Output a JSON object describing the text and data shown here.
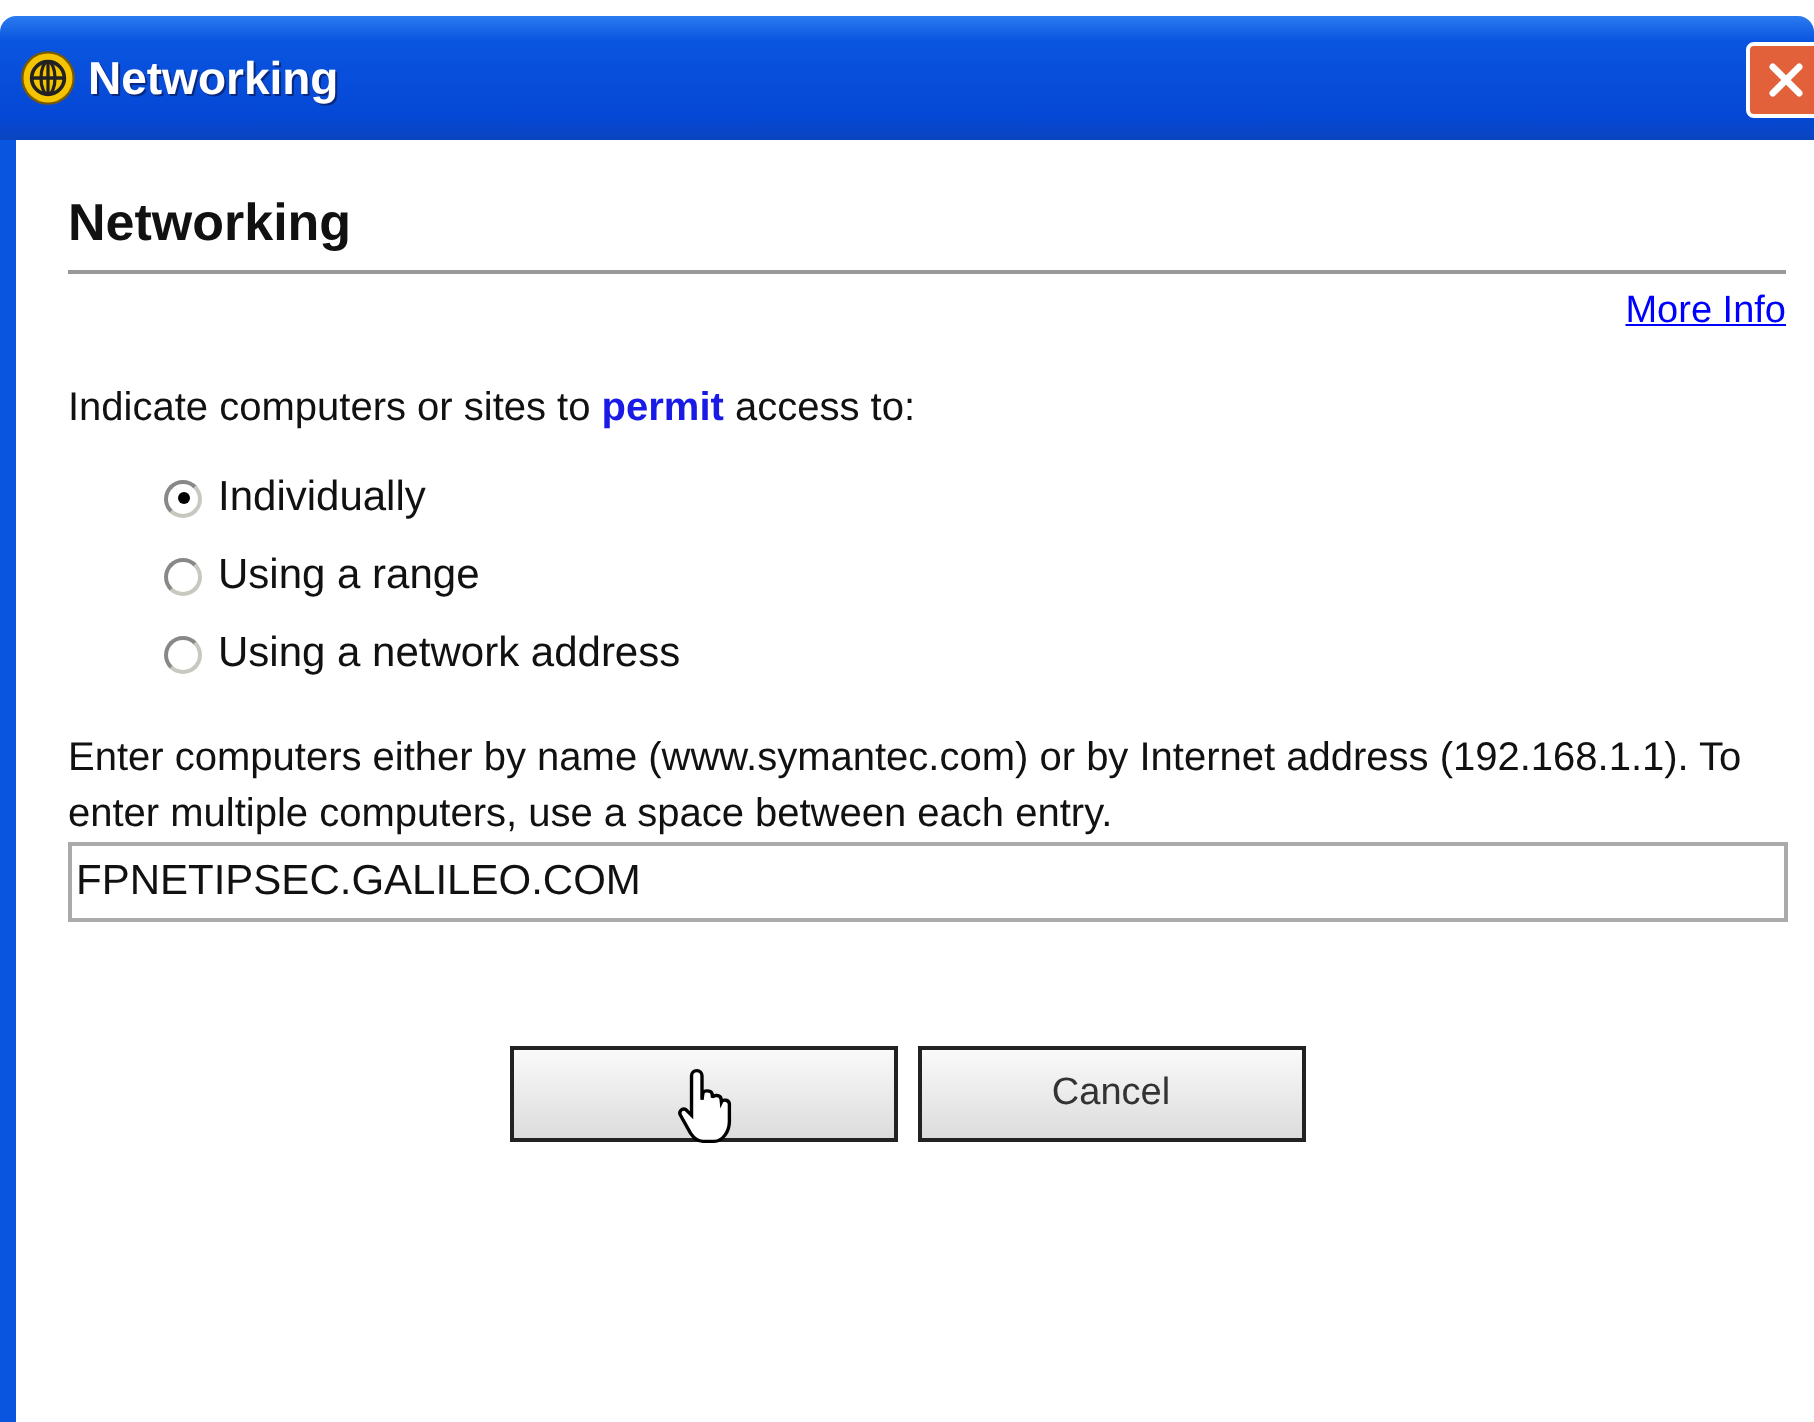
{
  "window": {
    "title": "Networking"
  },
  "heading": "Networking",
  "more_info_link": "More Info",
  "prompt": "Indicate computers or sites to **permit** access to:",
  "options": [
    {
      "label": "Individually",
      "selected": true
    },
    {
      "label": "Using a range",
      "selected": false
    },
    {
      "label": "Using a network address",
      "selected": false
    }
  ],
  "instructions": "Enter computers either by name (www.symantec.com) or by Internet address (192.168.1.1). To enter multiple computers, use a space between each entry.",
  "entry": {
    "value": "FPNETIPSEC.GALILEO.COM"
  },
  "buttons": [
    {
      "pointer_over": true
    },
    {
      "label": "Cancel",
      "pointer_over": false
    }
  ]
}
